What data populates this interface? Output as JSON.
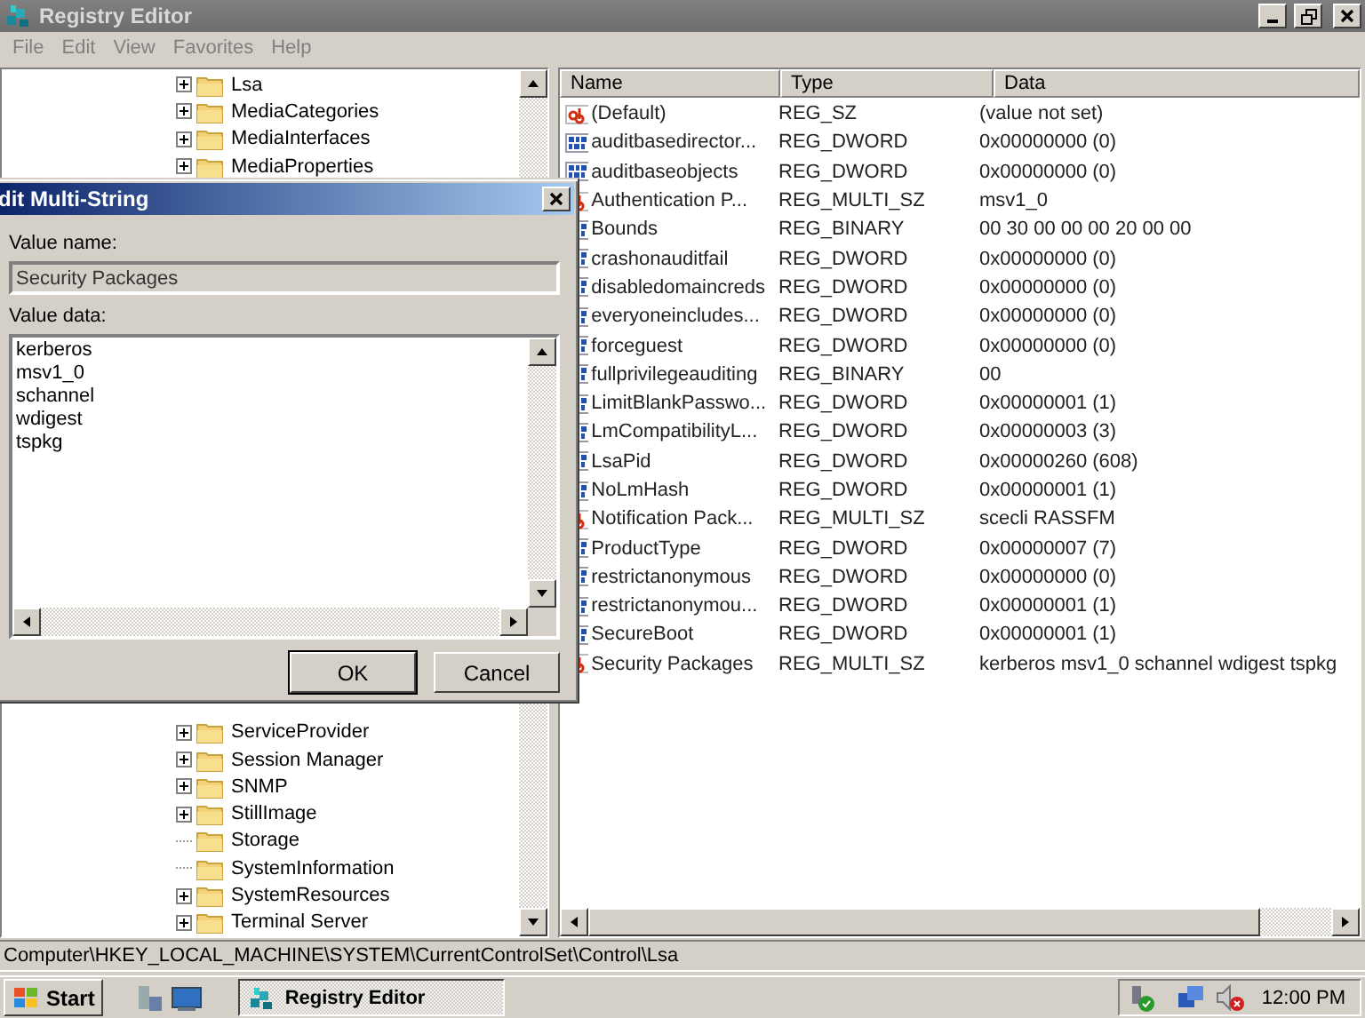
{
  "window": {
    "title": "Registry Editor"
  },
  "menu": [
    "File",
    "Edit",
    "View",
    "Favorites",
    "Help"
  ],
  "tree": {
    "upper": [
      {
        "label": "Lsa",
        "expandable": true
      },
      {
        "label": "MediaCategories",
        "expandable": true
      },
      {
        "label": "MediaInterfaces",
        "expandable": true
      },
      {
        "label": "MediaProperties",
        "expandable": true
      }
    ],
    "lower": [
      {
        "label": "ServiceProvider",
        "expandable": true
      },
      {
        "label": "Session Manager",
        "expandable": true
      },
      {
        "label": "SNMP",
        "expandable": true
      },
      {
        "label": "StillImage",
        "expandable": true
      },
      {
        "label": "Storage",
        "expandable": false
      },
      {
        "label": "SystemInformation",
        "expandable": false
      },
      {
        "label": "SystemResources",
        "expandable": true
      },
      {
        "label": "Terminal Server",
        "expandable": true
      }
    ]
  },
  "list": {
    "columns": [
      "Name",
      "Type",
      "Data"
    ],
    "rows": [
      {
        "kind": "string",
        "name": "(Default)",
        "type": "REG_SZ",
        "data": "(value not set)"
      },
      {
        "kind": "binary",
        "name": "auditbasedirector...",
        "type": "REG_DWORD",
        "data": "0x00000000 (0)"
      },
      {
        "kind": "binary",
        "name": "auditbaseobjects",
        "type": "REG_DWORD",
        "data": "0x00000000 (0)"
      },
      {
        "kind": "string",
        "name": "Authentication P...",
        "type": "REG_MULTI_SZ",
        "data": "msv1_0"
      },
      {
        "kind": "binary",
        "name": "Bounds",
        "type": "REG_BINARY",
        "data": "00 30 00 00 00 20 00 00"
      },
      {
        "kind": "binary",
        "name": "crashonauditfail",
        "type": "REG_DWORD",
        "data": "0x00000000 (0)"
      },
      {
        "kind": "binary",
        "name": "disabledomaincreds",
        "type": "REG_DWORD",
        "data": "0x00000000 (0)"
      },
      {
        "kind": "binary",
        "name": "everyoneincludes...",
        "type": "REG_DWORD",
        "data": "0x00000000 (0)"
      },
      {
        "kind": "binary",
        "name": "forceguest",
        "type": "REG_DWORD",
        "data": "0x00000000 (0)"
      },
      {
        "kind": "binary",
        "name": "fullprivilegeauditing",
        "type": "REG_BINARY",
        "data": "00"
      },
      {
        "kind": "binary",
        "name": "LimitBlankPasswo...",
        "type": "REG_DWORD",
        "data": "0x00000001 (1)"
      },
      {
        "kind": "binary",
        "name": "LmCompatibilityL...",
        "type": "REG_DWORD",
        "data": "0x00000003 (3)"
      },
      {
        "kind": "binary",
        "name": "LsaPid",
        "type": "REG_DWORD",
        "data": "0x00000260 (608)"
      },
      {
        "kind": "binary",
        "name": "NoLmHash",
        "type": "REG_DWORD",
        "data": "0x00000001 (1)"
      },
      {
        "kind": "string",
        "name": "Notification Pack...",
        "type": "REG_MULTI_SZ",
        "data": "scecli RASSFM"
      },
      {
        "kind": "binary",
        "name": "ProductType",
        "type": "REG_DWORD",
        "data": "0x00000007 (7)"
      },
      {
        "kind": "binary",
        "name": "restrictanonymous",
        "type": "REG_DWORD",
        "data": "0x00000000 (0)"
      },
      {
        "kind": "binary",
        "name": "restrictanonymou...",
        "type": "REG_DWORD",
        "data": "0x00000001 (1)"
      },
      {
        "kind": "binary",
        "name": "SecureBoot",
        "type": "REG_DWORD",
        "data": "0x00000001 (1)"
      },
      {
        "kind": "string",
        "name": "Security Packages",
        "type": "REG_MULTI_SZ",
        "data": "kerberos msv1_0 schannel wdigest tspkg"
      }
    ]
  },
  "dialog": {
    "title": "dit Multi-String",
    "name_label": "Value name:",
    "name_value": "Security Packages",
    "data_label": "Value data:",
    "data_lines": [
      "kerberos",
      "msv1_0",
      "schannel",
      "wdigest",
      "tspkg"
    ],
    "buttons": [
      {
        "label": "OK",
        "default": true
      },
      {
        "label": "Cancel",
        "default": false
      }
    ]
  },
  "status_bar": "Computer\\HKEY_LOCAL_MACHINE\\SYSTEM\\CurrentControlSet\\Control\\Lsa",
  "taskbar": {
    "start": "Start",
    "tasks": [
      {
        "label": "Registry Editor",
        "selected": true
      }
    ],
    "clock": "12:00 PM"
  }
}
